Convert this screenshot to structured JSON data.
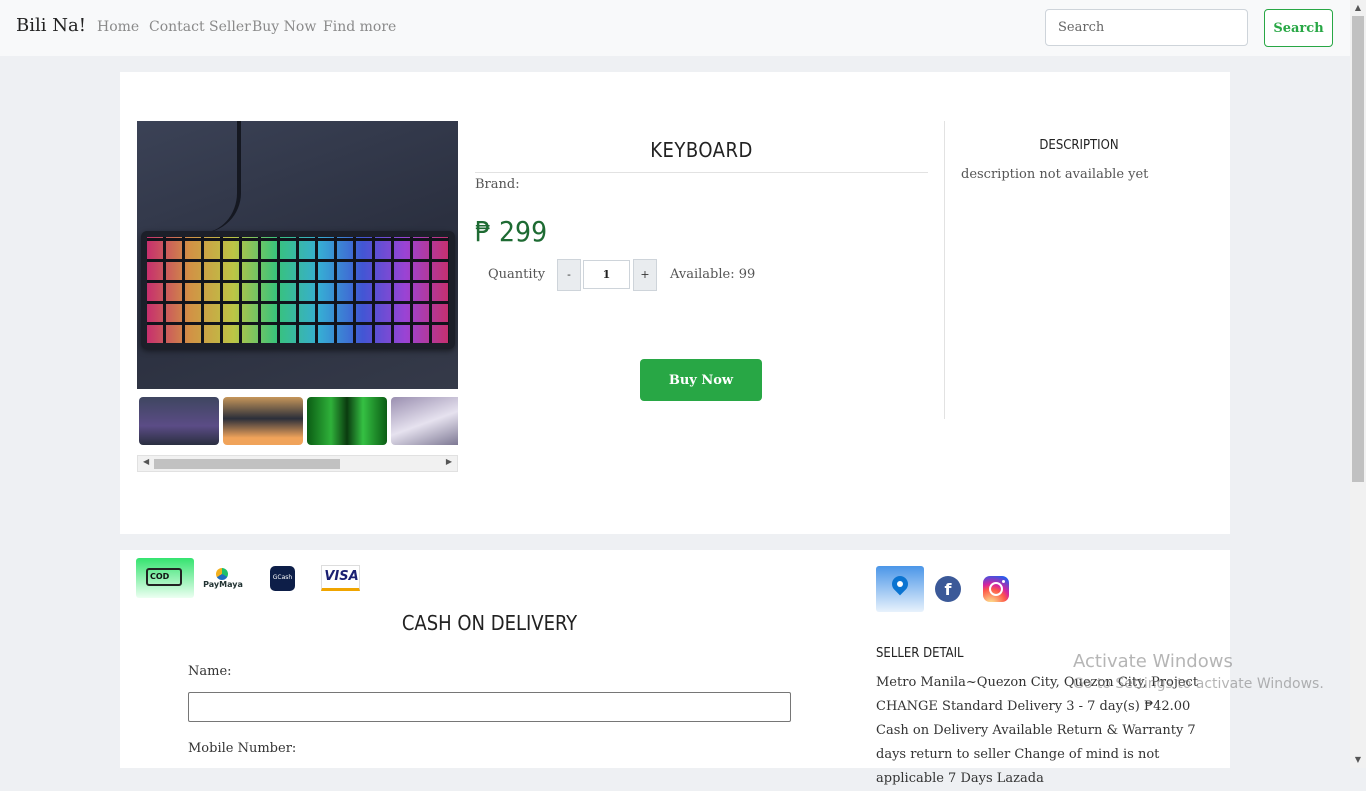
{
  "navbar": {
    "brand": "Bili Na!",
    "links": [
      "Home",
      "Contact Seller",
      "Buy Now",
      "Find more"
    ],
    "search_placeholder": "Search",
    "search_button": "Search"
  },
  "product": {
    "title": "KEYBOARD",
    "brand_label": "Brand:",
    "price": "₱ 299",
    "quantity_label": "Quantity",
    "quantity_value": "1",
    "decrement": "-",
    "increment": "+",
    "available": "Available: 99",
    "buy_button": "Buy Now",
    "thumbnail_count": 4
  },
  "description": {
    "title": "DESCRIPTION",
    "text": "description not available yet"
  },
  "payment": {
    "icons": [
      "cod-truck-icon",
      "paymaya-icon",
      "gcash-icon",
      "visa-icon"
    ],
    "cod_label": "COD",
    "paymaya_label": "PayMaya",
    "gcash_label": "GCash",
    "visa_label": "VISA",
    "title": "CASH ON DELIVERY",
    "name_label": "Name:",
    "mobile_label": "Mobile Number:"
  },
  "seller": {
    "icons": [
      "location-pin-icon",
      "facebook-icon",
      "instagram-icon"
    ],
    "title": "SELLER DETAIL",
    "text": "Metro Manila~Quezon City, Quezon City, Project CHANGE Standard Delivery 3 - 7 day(s) ₱42.00 Cash on Delivery Available Return & Warranty 7 days return to seller Change of mind is not applicable 7 Days Lazada"
  },
  "watermark": {
    "line1": "Activate Windows",
    "line2": "Go to Settings to activate Windows."
  },
  "colors": {
    "accent_green": "#28a745",
    "price_green": "#1e6b33"
  }
}
